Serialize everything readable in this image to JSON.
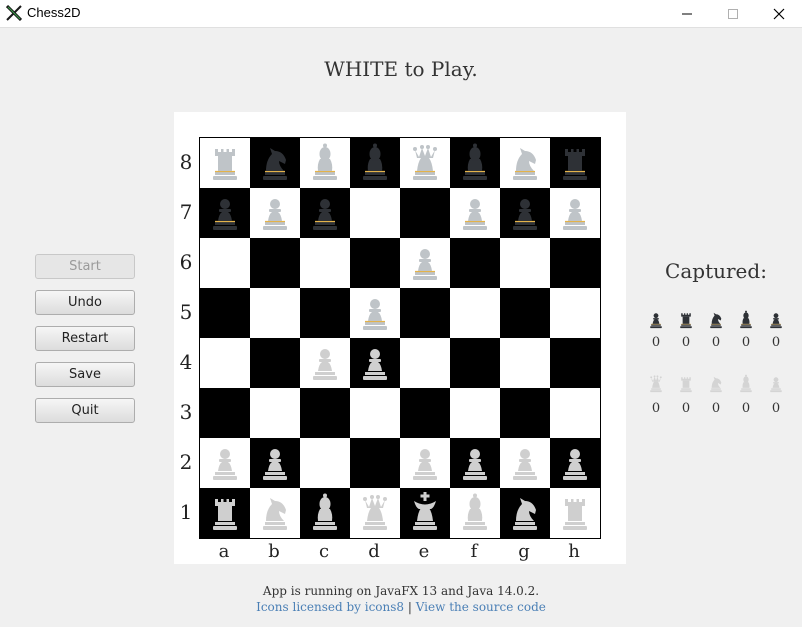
{
  "window": {
    "title": "Chess2D",
    "app_icon": "x-logo-icon",
    "controls": [
      "minimize-icon",
      "maximize-icon",
      "close-icon"
    ]
  },
  "status": {
    "turn_text": "WHITE to Play."
  },
  "buttons": {
    "start": "Start",
    "undo": "Undo",
    "restart": "Restart",
    "save": "Save",
    "quit": "Quit"
  },
  "board": {
    "files": [
      "a",
      "b",
      "c",
      "d",
      "e",
      "f",
      "g",
      "h"
    ],
    "ranks": [
      "8",
      "7",
      "6",
      "5",
      "4",
      "3",
      "2",
      "1"
    ],
    "position": [
      [
        "wR",
        "bN",
        "wB",
        "bB",
        "wQ",
        "bB",
        "wN",
        "bR"
      ],
      [
        "bP",
        "wP",
        "bP",
        "",
        "",
        "wP",
        "bP",
        "wP"
      ],
      [
        "",
        "",
        "",
        "",
        "wP",
        "",
        "",
        ""
      ],
      [
        "",
        "",
        "",
        "wP",
        "",
        "",
        "",
        ""
      ],
      [
        "",
        "",
        "xP",
        "xP",
        "",
        "",
        "",
        ""
      ],
      [
        "",
        "",
        "",
        "",
        "",
        "",
        "",
        ""
      ],
      [
        "xP",
        "xP",
        "",
        "",
        "xP",
        "xP",
        "xP",
        "xP"
      ],
      [
        "xR",
        "xN",
        "xB",
        "xQ",
        "xK",
        "xB",
        "xN",
        "xR"
      ]
    ],
    "colors": {
      "light_square": "#ffffff",
      "dark_square": "#000000",
      "white_piece_fill": "#bfc4c8",
      "black_piece_fill": "#2e3136",
      "piece_stripe": "#e3b24a",
      "lower_piece_fill": "#cfcfcf"
    }
  },
  "captured": {
    "title": "Captured:",
    "black": [
      {
        "piece": "pawn",
        "icon": "black-pawn-icon",
        "count": "0"
      },
      {
        "piece": "rook",
        "icon": "black-rook-icon",
        "count": "0"
      },
      {
        "piece": "knight",
        "icon": "black-knight-icon",
        "count": "0"
      },
      {
        "piece": "bishop",
        "icon": "black-bishop-icon",
        "count": "0"
      },
      {
        "piece": "pawn",
        "icon": "black-pawn-icon",
        "count": "0"
      }
    ],
    "white": [
      {
        "piece": "queen",
        "icon": "white-queen-icon",
        "count": "0"
      },
      {
        "piece": "rook",
        "icon": "white-rook-icon",
        "count": "0"
      },
      {
        "piece": "knight",
        "icon": "white-knight-icon",
        "count": "0"
      },
      {
        "piece": "bishop",
        "icon": "white-bishop-icon",
        "count": "0"
      },
      {
        "piece": "pawn",
        "icon": "white-pawn-icon",
        "count": "0"
      }
    ]
  },
  "footer": {
    "runtime": "App is running on JavaFX 13 and Java 14.0.2.",
    "icons_link": "Icons licensed by icons8",
    "separator": " | ",
    "source_link": "View the source code"
  }
}
